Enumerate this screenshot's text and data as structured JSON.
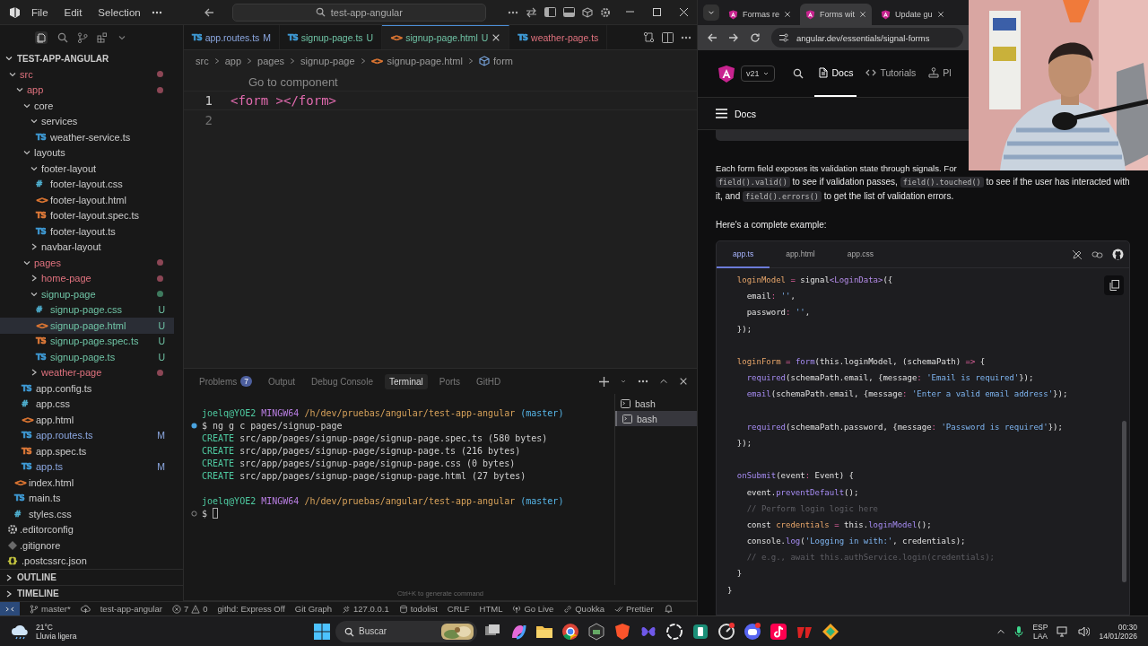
{
  "vscode": {
    "menu": [
      "File",
      "Edit",
      "Selection"
    ],
    "search": "test-app-angular",
    "explorer": {
      "title": "TEST-APP-ANGULAR",
      "expanded": true,
      "tree": [
        {
          "name": "src",
          "kind": "folder",
          "expanded": true,
          "problems": true,
          "selected": false,
          "children": [
            {
              "name": "app",
              "kind": "folder",
              "expanded": true,
              "problems": true,
              "selected": false,
              "children": [
                {
                  "name": "core",
                  "kind": "folder",
                  "expanded": true,
                  "selected": false,
                  "children": [
                    {
                      "name": "services",
                      "kind": "folder",
                      "expanded": true,
                      "selected": false,
                      "children": [
                        {
                          "name": "weather-service.ts",
                          "kind": "file",
                          "badge": "TS",
                          "color": "#3f9bd6",
                          "selected": false
                        }
                      ]
                    }
                  ]
                },
                {
                  "name": "layouts",
                  "kind": "folder",
                  "expanded": true,
                  "selected": false,
                  "children": [
                    {
                      "name": "footer-layout",
                      "kind": "folder",
                      "expanded": true,
                      "selected": false,
                      "children": [
                        {
                          "name": "footer-layout.css",
                          "kind": "file",
                          "badge": "#",
                          "color": "#4fb0d0",
                          "selected": false
                        },
                        {
                          "name": "footer-layout.html",
                          "kind": "file",
                          "badge": "<>",
                          "color": "#e37933",
                          "selected": false
                        },
                        {
                          "name": "footer-layout.spec.ts",
                          "kind": "file",
                          "badge": "TS",
                          "color": "#e07b39",
                          "selected": false
                        },
                        {
                          "name": "footer-layout.ts",
                          "kind": "file",
                          "badge": "TS",
                          "color": "#3f9bd6",
                          "selected": false
                        }
                      ]
                    },
                    {
                      "name": "navbar-layout",
                      "kind": "folder",
                      "expanded": false,
                      "selected": false
                    }
                  ]
                },
                {
                  "name": "pages",
                  "kind": "folder",
                  "expanded": true,
                  "problems": true,
                  "selected": false,
                  "children": [
                    {
                      "name": "home-page",
                      "kind": "folder",
                      "expanded": false,
                      "problems": true,
                      "selected": false
                    },
                    {
                      "name": "signup-page",
                      "kind": "folder",
                      "expanded": true,
                      "untracked": true,
                      "selected": false,
                      "children": [
                        {
                          "name": "signup-page.css",
                          "kind": "file",
                          "badge": "#",
                          "color": "#4fb0d0",
                          "untracked": true,
                          "letter": "U",
                          "selected": false
                        },
                        {
                          "name": "signup-page.html",
                          "kind": "file",
                          "badge": "<>",
                          "color": "#e37933",
                          "untracked": true,
                          "letter": "U",
                          "selected": true
                        },
                        {
                          "name": "signup-page.spec.ts",
                          "kind": "file",
                          "badge": "TS",
                          "color": "#e07b39",
                          "untracked": true,
                          "letter": "U",
                          "selected": false
                        },
                        {
                          "name": "signup-page.ts",
                          "kind": "file",
                          "badge": "TS",
                          "color": "#3f9bd6",
                          "untracked": true,
                          "letter": "U",
                          "selected": false
                        }
                      ]
                    },
                    {
                      "name": "weather-page",
                      "kind": "folder",
                      "expanded": false,
                      "problems": true,
                      "selected": false
                    }
                  ]
                },
                {
                  "name": "app.config.ts",
                  "kind": "file",
                  "badge": "TS",
                  "color": "#3f9bd6",
                  "selected": false
                },
                {
                  "name": "app.css",
                  "kind": "file",
                  "badge": "#",
                  "color": "#4fb0d0",
                  "selected": false
                },
                {
                  "name": "app.html",
                  "kind": "file",
                  "badge": "<>",
                  "color": "#e37933",
                  "selected": false
                },
                {
                  "name": "app.routes.ts",
                  "kind": "file",
                  "badge": "TS",
                  "color": "#3f9bd6",
                  "modified": true,
                  "letter": "M",
                  "selected": false
                },
                {
                  "name": "app.spec.ts",
                  "kind": "file",
                  "badge": "TS",
                  "color": "#e07b39",
                  "selected": false
                },
                {
                  "name": "app.ts",
                  "kind": "file",
                  "badge": "TS",
                  "color": "#3f9bd6",
                  "modified": true,
                  "letter": "M",
                  "selected": false
                }
              ]
            },
            {
              "name": "index.html",
              "kind": "file",
              "badge": "<>",
              "color": "#e37933",
              "selected": false
            },
            {
              "name": "main.ts",
              "kind": "file",
              "badge": "TS",
              "color": "#3f9bd6",
              "selected": false
            },
            {
              "name": "styles.css",
              "kind": "file",
              "badge": "#",
              "color": "#4fb0d0",
              "selected": false
            }
          ]
        },
        {
          "name": ".editorconfig",
          "kind": "settings-file",
          "selected": false
        },
        {
          "name": ".gitignore",
          "kind": "ignore-file",
          "selected": false
        },
        {
          "name": ".postcssrc.json",
          "kind": "file",
          "badge": "{}",
          "color": "#cbcb41",
          "selected": false
        }
      ]
    },
    "sections": [
      {
        "title": "OUTLINE",
        "expanded": false
      },
      {
        "title": "TIMELINE",
        "expanded": false
      }
    ],
    "tabs": [
      {
        "badge": "TS",
        "color": "#3f9bd6",
        "label": "app.routes.ts",
        "letter": "M",
        "modified": true,
        "selected": false
      },
      {
        "badge": "TS",
        "color": "#3f9bd6",
        "label": "signup-page.ts",
        "letter": "U",
        "untracked": true,
        "selected": false
      },
      {
        "badge": "<>",
        "color": "#e37933",
        "label": "signup-page.html",
        "letter": "U",
        "untracked": true,
        "selected": true
      },
      {
        "badge": "TS",
        "color": "#3f9bd6",
        "label": "weather-page.ts",
        "problems": true,
        "selected": false
      }
    ],
    "breadcrumbs": [
      {
        "kind": "folder",
        "text": "src"
      },
      {
        "kind": "folder",
        "text": "app"
      },
      {
        "kind": "folder",
        "text": "pages"
      },
      {
        "kind": "folder",
        "text": "signup-page"
      },
      {
        "kind": "file",
        "badge": "<>",
        "color": "#e37933",
        "text": "signup-page.html"
      },
      {
        "kind": "symbol",
        "text": "form"
      }
    ],
    "editor": {
      "codelens": "Go to component",
      "lines": [
        {
          "number": "1",
          "code": "<form ></form>",
          "current": true
        },
        {
          "number": "2",
          "current": false
        }
      ]
    },
    "panel": {
      "tabs": [
        {
          "label": "Problems",
          "count": "7",
          "selected": false
        },
        {
          "label": "Output",
          "selected": false
        },
        {
          "label": "Debug Console",
          "selected": false
        },
        {
          "label": "Terminal",
          "selected": true
        },
        {
          "label": "Ports",
          "selected": false
        },
        {
          "label": "GitHD",
          "selected": false
        }
      ],
      "terminal": [
        {
          "kind": "prompt",
          "text": "joelq@YOE2 MINGW64 /h/dev/pruebas/angular/test-app-angular (master)"
        },
        {
          "kind": "command",
          "finished": true,
          "text": "$ ng g c pages/signup-page"
        },
        {
          "kind": "create",
          "text": "CREATE src/app/pages/signup-page/signup-page.spec.ts (580 bytes)"
        },
        {
          "kind": "create",
          "text": "CREATE src/app/pages/signup-page/signup-page.ts (216 bytes)"
        },
        {
          "kind": "create",
          "text": "CREATE src/app/pages/signup-page/signup-page.css (0 bytes)"
        },
        {
          "kind": "create",
          "text": "CREATE src/app/pages/signup-page/signup-page.html (27 bytes)"
        },
        {
          "kind": "blank"
        },
        {
          "kind": "prompt",
          "text": "joelq@YOE2 MINGW64 /h/dev/pruebas/angular/test-app-angular (master)"
        },
        {
          "kind": "input",
          "finished": false,
          "text": "$"
        }
      ],
      "shells": [
        {
          "label": "bash",
          "selected": false
        },
        {
          "label": "bash",
          "selected": true
        }
      ]
    },
    "hint": "Ctrl+K to generate command",
    "status_bar": [
      {
        "kind": "remote"
      },
      {
        "kind": "branch",
        "text": "master*"
      },
      {
        "kind": "sync"
      },
      {
        "kind": "plain",
        "text": "test-app-angular"
      },
      {
        "kind": "problems",
        "errors": "7",
        "warnings": "0"
      },
      {
        "kind": "plain",
        "text": "githd: Express Off"
      },
      {
        "kind": "plain",
        "text": "Git Graph"
      },
      {
        "kind": "server",
        "text": "127.0.0.1"
      },
      {
        "kind": "database",
        "text": "todolist"
      },
      {
        "kind": "plain",
        "text": "CRLF"
      },
      {
        "kind": "plain",
        "text": "HTML"
      },
      {
        "kind": "broadcast",
        "text": "Go Live"
      },
      {
        "kind": "link",
        "text": "Quokka"
      },
      {
        "kind": "checks",
        "text": "Prettier"
      },
      {
        "kind": "bell"
      }
    ]
  },
  "browser": {
    "tabs": [
      {
        "title": "Formas re",
        "selected": false
      },
      {
        "title": "Forms wit",
        "selected": true
      },
      {
        "title": "Update gu",
        "selected": false
      }
    ],
    "url": "angular.dev/essentials/signal-forms",
    "version": "v21",
    "nav": [
      {
        "kind": "doc",
        "label": "Docs",
        "selected": true
      },
      {
        "kind": "code",
        "label": "Tutorials",
        "selected": false
      },
      {
        "kind": "joystick",
        "label": "Pl",
        "selected": false
      }
    ],
    "docs_bar": "Docs",
    "intro": "Each form field exposes its validation state through signals. For",
    "paragraph": [
      {
        "text": "field().valid()",
        "code": true
      },
      {
        "text": "to see if validation passes,",
        "code": false
      },
      {
        "text": "field().touched()",
        "code": true
      },
      {
        "text": "to see if the user has interacted with it, and",
        "code": false
      },
      {
        "text": "field().errors()",
        "code": true
      },
      {
        "text": "to get the list of validation errors.",
        "code": false
      }
    ],
    "example_label": "Here's a complete example:",
    "code_tabs": [
      {
        "label": "app.ts",
        "selected": true
      },
      {
        "label": "app.html",
        "selected": false
      },
      {
        "label": "app.css",
        "selected": false
      }
    ],
    "code": [
      {
        "text": "  loginModel = signal<LoginData>({"
      },
      {
        "text": "    email: '',"
      },
      {
        "text": "    password: '',"
      },
      {
        "text": "  });"
      },
      {
        "kind": "blank"
      },
      {
        "text": "  loginForm = form(this.loginModel, (schemaPath) => {"
      },
      {
        "text": "    required(schemaPath.email, {message: 'Email is required'});"
      },
      {
        "text": "    email(schemaPath.email, {message: 'Enter a valid email address'});"
      },
      {
        "kind": "blank"
      },
      {
        "text": "    required(schemaPath.password, {message: 'Password is required'});"
      },
      {
        "text": "  });"
      },
      {
        "kind": "blank"
      },
      {
        "text": "  onSubmit(event: Event) {"
      },
      {
        "text": "    event.preventDefault();"
      },
      {
        "text": "    // Perform login logic here"
      },
      {
        "text": "    const credentials = this.loginModel();"
      },
      {
        "text": "    console.log('Logging in with:', credentials);"
      },
      {
        "text": "    // e.g., await this.authService.login(credentials);"
      },
      {
        "text": "  }"
      },
      {
        "text": "}"
      }
    ]
  },
  "taskbar": {
    "weather": {
      "temp": "21°C",
      "desc": "Lluvia ligera"
    },
    "search": {
      "placeholder": "Buscar"
    },
    "language": [
      "ESP",
      "LAA"
    ],
    "time": "00:30",
    "date": "14/01/2026"
  }
}
